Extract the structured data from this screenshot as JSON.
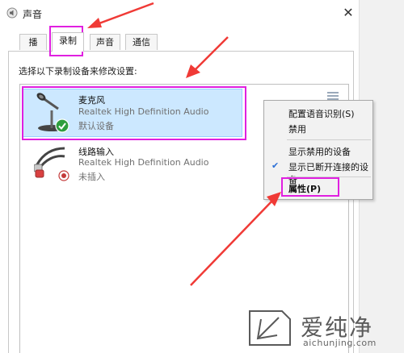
{
  "window": {
    "title": "声音",
    "close_glyph": "✕"
  },
  "tabs": [
    {
      "label": "播放",
      "active": false
    },
    {
      "label": "录制",
      "active": true
    },
    {
      "label": "声音",
      "active": false
    },
    {
      "label": "通信",
      "active": false
    }
  ],
  "instruction": "选择以下录制设备来修改设置:",
  "devices": [
    {
      "name": "麦克风",
      "driver": "Realtek High Definition Audio",
      "status": "默认设备",
      "selected": true,
      "icon": "microphone-icon",
      "badge": "default-check-icon"
    },
    {
      "name": "线路输入",
      "driver": "Realtek High Definition Audio",
      "status": "未插入",
      "selected": false,
      "icon": "line-in-cable-icon",
      "badge": "unplugged-icon"
    }
  ],
  "context_menu": {
    "items": [
      {
        "label": "配置语音识别(S)",
        "checked": false
      },
      {
        "label": "禁用",
        "checked": false
      },
      {
        "label": "显示禁用的设备",
        "checked": false
      },
      {
        "label": "显示已断开连接的设备",
        "checked": true
      },
      {
        "label": "属性(P)",
        "checked": false,
        "bold": true
      }
    ],
    "check_glyph": "✔"
  },
  "watermark": {
    "text": "爱纯净",
    "url": "aichunjing.com"
  },
  "colors": {
    "highlight": "#e020e0",
    "arrow": "#f03a36",
    "selection": "#cce8ff",
    "check_blue": "#2b6fd6",
    "default_green": "#2e9e3e"
  }
}
